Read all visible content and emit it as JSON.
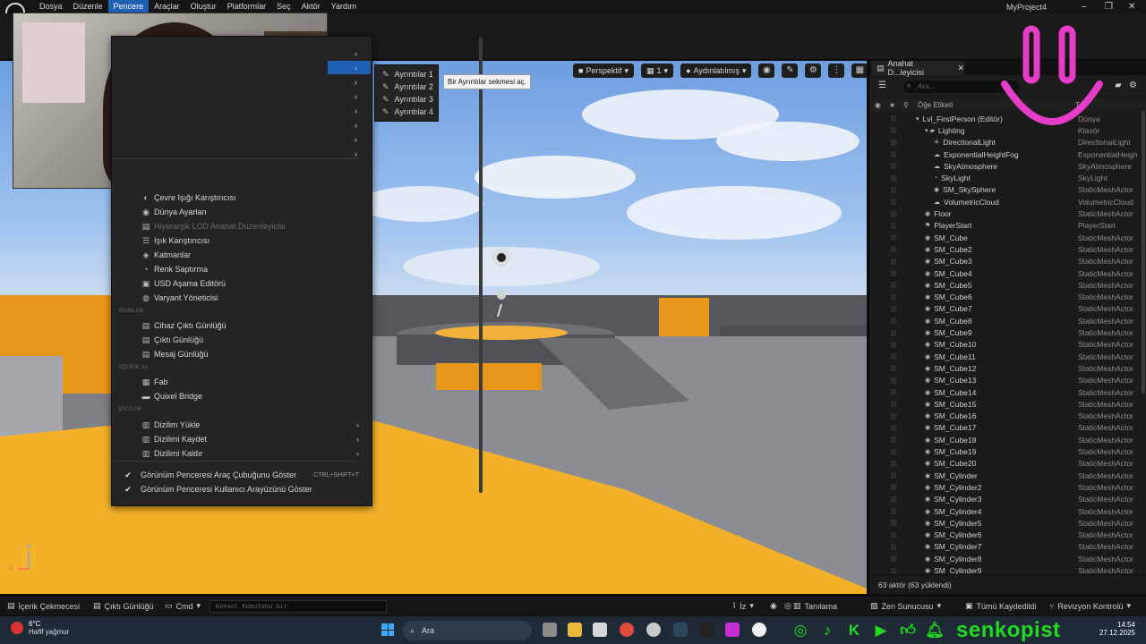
{
  "menubar": {
    "items": [
      "Dosya",
      "Düzenle",
      "Pencere",
      "Araçlar",
      "Oluştur",
      "Platformlar",
      "Seç",
      "Aktör",
      "Yardım"
    ],
    "active": "Pencere",
    "project_name": "MyProject4",
    "win_minimize": "–",
    "win_restore": "❐",
    "win_close": "✕"
  },
  "viewport": {
    "perspective": "Perspektif",
    "camera_speed": "1",
    "lit_mode": "Aydınlatılmış",
    "axis_x": "x",
    "axis_z": "z"
  },
  "window_menu": {
    "items": [
      {
        "label": "Çevre Işığı Karıştırıcısı",
        "icon": "mixer-icon",
        "glyph": "◐",
        "disabled": false
      },
      {
        "label": "Dünya Ayarları",
        "icon": "globe-icon",
        "glyph": "◉",
        "disabled": false
      },
      {
        "label": "Hiyerarşik LOD Anahat Düzenleyicisi",
        "icon": "lod-icon",
        "glyph": "▤",
        "disabled": true
      },
      {
        "label": "Işık Karıştırıcısı",
        "icon": "light-mixer-icon",
        "glyph": "☰",
        "disabled": false
      },
      {
        "label": "Katmanlar",
        "icon": "layers-icon",
        "glyph": "◈",
        "disabled": false
      },
      {
        "label": "Renk Saptırma",
        "icon": "color-grading-icon",
        "glyph": "◔",
        "disabled": false
      },
      {
        "label": "USD Aşama Editörü",
        "icon": "usd-icon",
        "glyph": "▣",
        "disabled": false
      },
      {
        "label": "Varyant Yöneticisi",
        "icon": "variant-icon",
        "glyph": "◍",
        "disabled": false
      }
    ],
    "section_log": "GÜNLÜK",
    "log_items": [
      {
        "label": "Cihaz Çıktı Günlüğü",
        "icon": "device-log-icon",
        "glyph": "▤"
      },
      {
        "label": "Çıktı Günlüğü",
        "icon": "output-log-icon",
        "glyph": "▤"
      },
      {
        "label": "Mesaj Günlüğü",
        "icon": "message-log-icon",
        "glyph": "▤"
      }
    ],
    "section_content": "İÇERİK AL",
    "content_items": [
      {
        "label": "Fab",
        "icon": "fab-icon",
        "glyph": "▦"
      },
      {
        "label": "Quixel Bridge",
        "icon": "bridge-icon",
        "glyph": "▬"
      }
    ],
    "section_layout": "DİZİLİM",
    "layout_items": [
      {
        "label": "Dizilim Yükle",
        "icon": "layout-load-icon",
        "glyph": "▥"
      },
      {
        "label": "Dizilimi Kaydet",
        "icon": "layout-save-icon",
        "glyph": "▥"
      },
      {
        "label": "Dizilimi Kaldır",
        "icon": "layout-remove-icon",
        "glyph": "▥"
      }
    ],
    "check_items": [
      {
        "label": "Görünüm Penceresi Araç Çubuğunu Göster",
        "shortcut": "CTRL+SHIFT+T"
      },
      {
        "label": "Görünüm Penceresi Kullanıcı Arayüzünü Göster",
        "shortcut": ""
      }
    ]
  },
  "submenu": {
    "items": [
      "Ayrıntılar 1",
      "Ayrıntılar 2",
      "Ayrıntılar 3",
      "Ayrıntılar 4"
    ],
    "tooltip": "Bir Ayrıntılar sekmesi aç."
  },
  "outliner": {
    "tab_label": "Anahat D...leyicisi",
    "search_placeholder": "Ara...",
    "col_label": "Öğe Etiketi",
    "col_type": "Tür",
    "rows": [
      {
        "label": "Lvl_FirstPerson (Editör)",
        "type": "Dünya",
        "indent": 1,
        "icon": "▾"
      },
      {
        "label": "Lighting",
        "type": "Klasör",
        "indent": 2,
        "icon": "▾ ▰"
      },
      {
        "label": "DirectionalLight",
        "type": "DirectionalLight",
        "indent": 3,
        "icon": "☀"
      },
      {
        "label": "ExponentialHeightFog",
        "type": "ExponentialHeigh",
        "indent": 3,
        "icon": "☁"
      },
      {
        "label": "SkyAtmosphere",
        "type": "SkyAtmosphere",
        "indent": 3,
        "icon": "☁"
      },
      {
        "label": "SkyLight",
        "type": "SkyLight",
        "indent": 3,
        "icon": "◔"
      },
      {
        "label": "SM_SkySphere",
        "type": "StaticMeshActor",
        "indent": 3,
        "icon": "◉"
      },
      {
        "label": "VolumetricCloud",
        "type": "VolumetricCloud",
        "indent": 3,
        "icon": "☁"
      },
      {
        "label": "Floor",
        "type": "StaticMeshActor",
        "indent": 2,
        "icon": "◉"
      },
      {
        "label": "PlayerStart",
        "type": "PlayerStart",
        "indent": 2,
        "icon": "⚑"
      },
      {
        "label": "SM_Cube",
        "type": "StaticMeshActor",
        "indent": 2,
        "icon": "◉"
      },
      {
        "label": "SM_Cube2",
        "type": "StaticMeshActor",
        "indent": 2,
        "icon": "◉"
      },
      {
        "label": "SM_Cube3",
        "type": "StaticMeshActor",
        "indent": 2,
        "icon": "◉"
      },
      {
        "label": "SM_Cube4",
        "type": "StaticMeshActor",
        "indent": 2,
        "icon": "◉"
      },
      {
        "label": "SM_Cube5",
        "type": "StaticMeshActor",
        "indent": 2,
        "icon": "◉"
      },
      {
        "label": "SM_Cube6",
        "type": "StaticMeshActor",
        "indent": 2,
        "icon": "◉"
      },
      {
        "label": "SM_Cube7",
        "type": "StaticMeshActor",
        "indent": 2,
        "icon": "◉"
      },
      {
        "label": "SM_Cube8",
        "type": "StaticMeshActor",
        "indent": 2,
        "icon": "◉"
      },
      {
        "label": "SM_Cube9",
        "type": "StaticMeshActor",
        "indent": 2,
        "icon": "◉"
      },
      {
        "label": "SM_Cube10",
        "type": "StaticMeshActor",
        "indent": 2,
        "icon": "◉"
      },
      {
        "label": "SM_Cube11",
        "type": "StaticMeshActor",
        "indent": 2,
        "icon": "◉"
      },
      {
        "label": "SM_Cube12",
        "type": "StaticMeshActor",
        "indent": 2,
        "icon": "◉"
      },
      {
        "label": "SM_Cube13",
        "type": "StaticMeshActor",
        "indent": 2,
        "icon": "◉"
      },
      {
        "label": "SM_Cube14",
        "type": "StaticMeshActor",
        "indent": 2,
        "icon": "◉"
      },
      {
        "label": "SM_Cube15",
        "type": "StaticMeshActor",
        "indent": 2,
        "icon": "◉"
      },
      {
        "label": "SM_Cube16",
        "type": "StaticMeshActor",
        "indent": 2,
        "icon": "◉"
      },
      {
        "label": "SM_Cube17",
        "type": "StaticMeshActor",
        "indent": 2,
        "icon": "◉"
      },
      {
        "label": "SM_Cube18",
        "type": "StaticMeshActor",
        "indent": 2,
        "icon": "◉"
      },
      {
        "label": "SM_Cube19",
        "type": "StaticMeshActor",
        "indent": 2,
        "icon": "◉"
      },
      {
        "label": "SM_Cube20",
        "type": "StaticMeshActor",
        "indent": 2,
        "icon": "◉"
      },
      {
        "label": "SM_Cylinder",
        "type": "StaticMeshActor",
        "indent": 2,
        "icon": "◉"
      },
      {
        "label": "SM_Cylinder2",
        "type": "StaticMeshActor",
        "indent": 2,
        "icon": "◉"
      },
      {
        "label": "SM_Cylinder3",
        "type": "StaticMeshActor",
        "indent": 2,
        "icon": "◉"
      },
      {
        "label": "SM_Cylinder4",
        "type": "StaticMeshActor",
        "indent": 2,
        "icon": "◉"
      },
      {
        "label": "SM_Cylinder5",
        "type": "StaticMeshActor",
        "indent": 2,
        "icon": "◉"
      },
      {
        "label": "SM_Cylinder6",
        "type": "StaticMeshActor",
        "indent": 2,
        "icon": "◉"
      },
      {
        "label": "SM_Cylinder7",
        "type": "StaticMeshActor",
        "indent": 2,
        "icon": "◉"
      },
      {
        "label": "SM_Cylinder8",
        "type": "StaticMeshActor",
        "indent": 2,
        "icon": "◉"
      },
      {
        "label": "SM_Cylinder9",
        "type": "StaticMeshActor",
        "indent": 2,
        "icon": "◉"
      }
    ],
    "footer": "63 aktör (63 yüklendi)"
  },
  "statusbar": {
    "content_drawer": "İçerik Çekmecesi",
    "output_log": "Çıktı Günlüğü",
    "cmd": "Cmd",
    "console_placeholder": "Konsol Komutunu Gir",
    "trace": "İz",
    "derive": "Tanılama",
    "zen": "Zen Sunucusu",
    "saved": "Tümü Kaydedildi",
    "revision": "Revizyon Kontrolü"
  },
  "taskbar": {
    "temperature": "6°C",
    "weather": "Hafif yağmur",
    "search_label": "Ara",
    "social_handle": "senkopist",
    "time": "14:54",
    "date": "27.12.2025"
  },
  "colors": {
    "accent": "#1f5fb4",
    "social_green": "#22d922",
    "smiley_pink": "#e63cc8",
    "orange_block": "#f0a020"
  }
}
